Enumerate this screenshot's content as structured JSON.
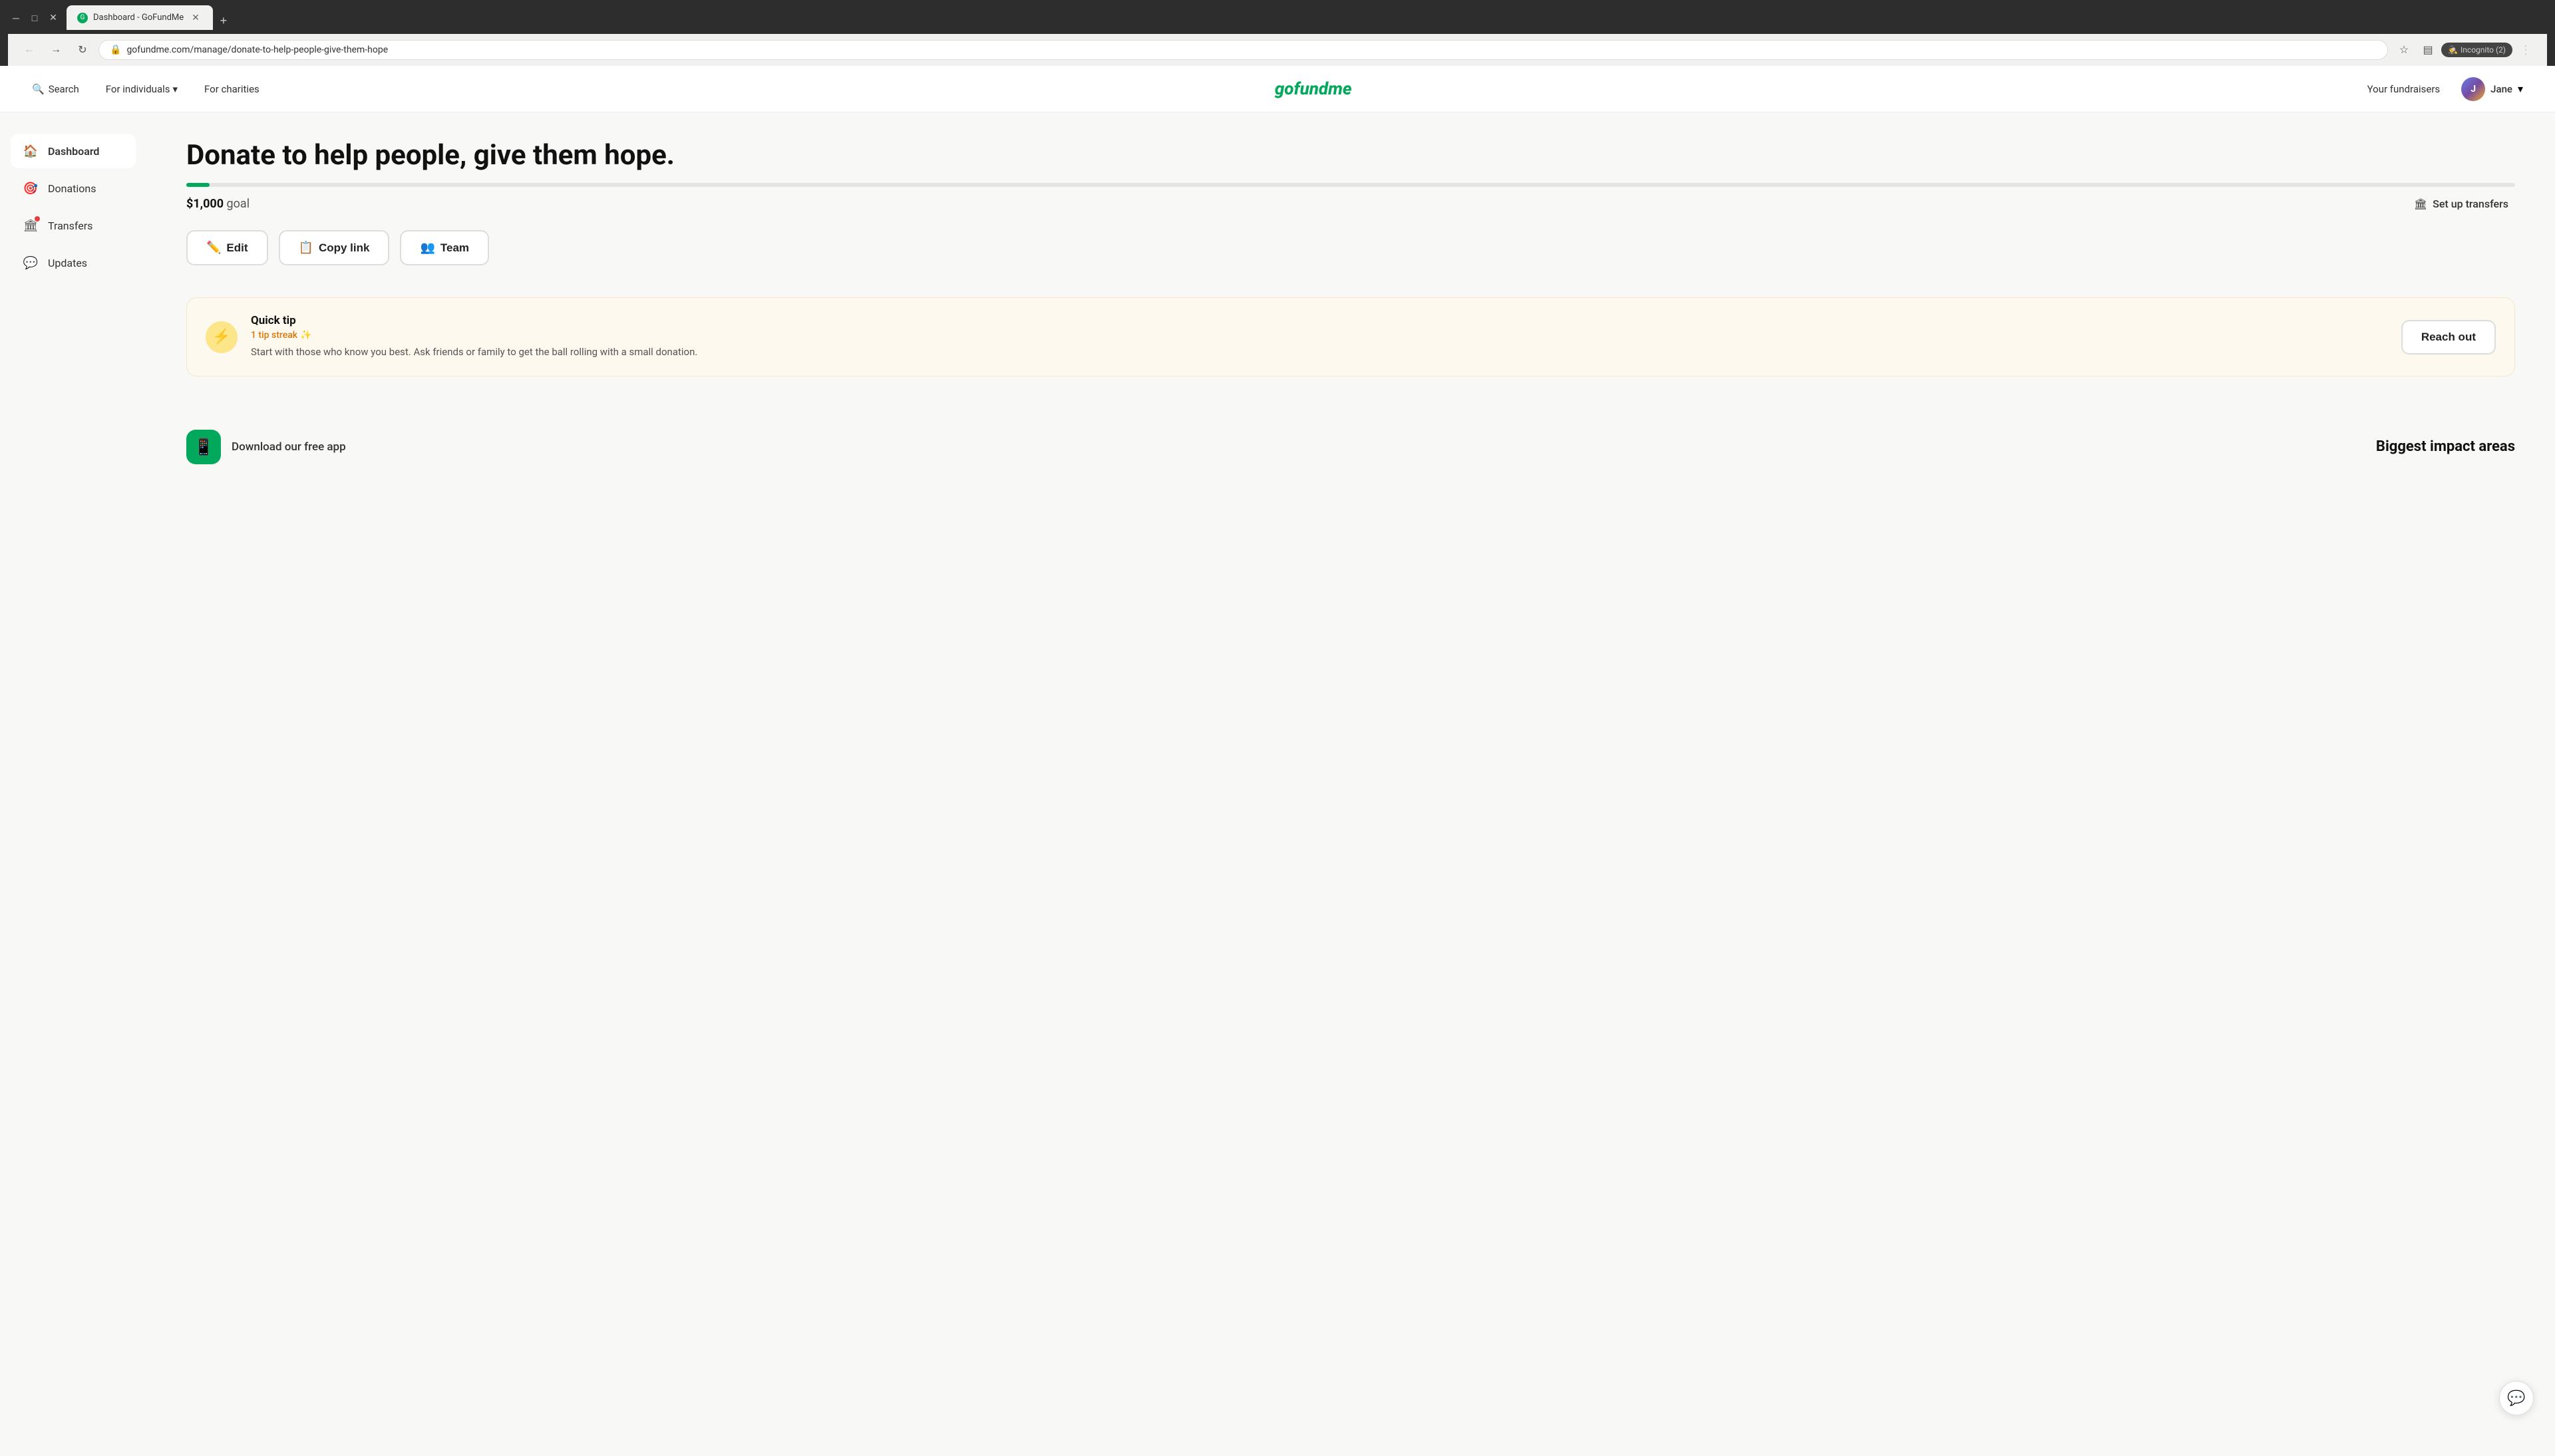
{
  "browser": {
    "tab_title": "Dashboard - GoFundMe",
    "tab_favicon": "G",
    "url": "gofundme.com/manage/donate-to-help-people-give-them-hope",
    "incognito_label": "Incognito (2)",
    "new_tab_label": "+"
  },
  "nav": {
    "search_label": "Search",
    "for_individuals_label": "For individuals",
    "for_charities_label": "For charities",
    "logo_text": "gofundme",
    "your_fundraisers_label": "Your fundraisers",
    "user_name": "Jane"
  },
  "sidebar": {
    "items": [
      {
        "id": "dashboard",
        "label": "Dashboard",
        "icon": "🏠",
        "active": true
      },
      {
        "id": "donations",
        "label": "Donations",
        "icon": "🎯",
        "active": false
      },
      {
        "id": "transfers",
        "label": "Transfers",
        "icon": "🏛",
        "active": false,
        "badge": true
      },
      {
        "id": "updates",
        "label": "Updates",
        "icon": "💬",
        "active": false
      }
    ]
  },
  "main": {
    "fundraiser_title": "Donate to help people, give them hope.",
    "goal_amount": "$1,000",
    "goal_label": "goal",
    "progress_percent": 1,
    "setup_transfers_label": "Set up transfers",
    "buttons": {
      "edit": "Edit",
      "copy_link": "Copy link",
      "team": "Team"
    },
    "quick_tip": {
      "title": "Quick tip",
      "streak_label": "1 tip streak",
      "streak_emoji": "✨",
      "text": "Start with those who know you best. Ask friends or family to get the ball rolling with a small donation.",
      "reach_out_label": "Reach out"
    },
    "download_app": {
      "label": "Download our free app",
      "icon": "📱"
    },
    "biggest_impact_label": "Biggest impact areas"
  }
}
